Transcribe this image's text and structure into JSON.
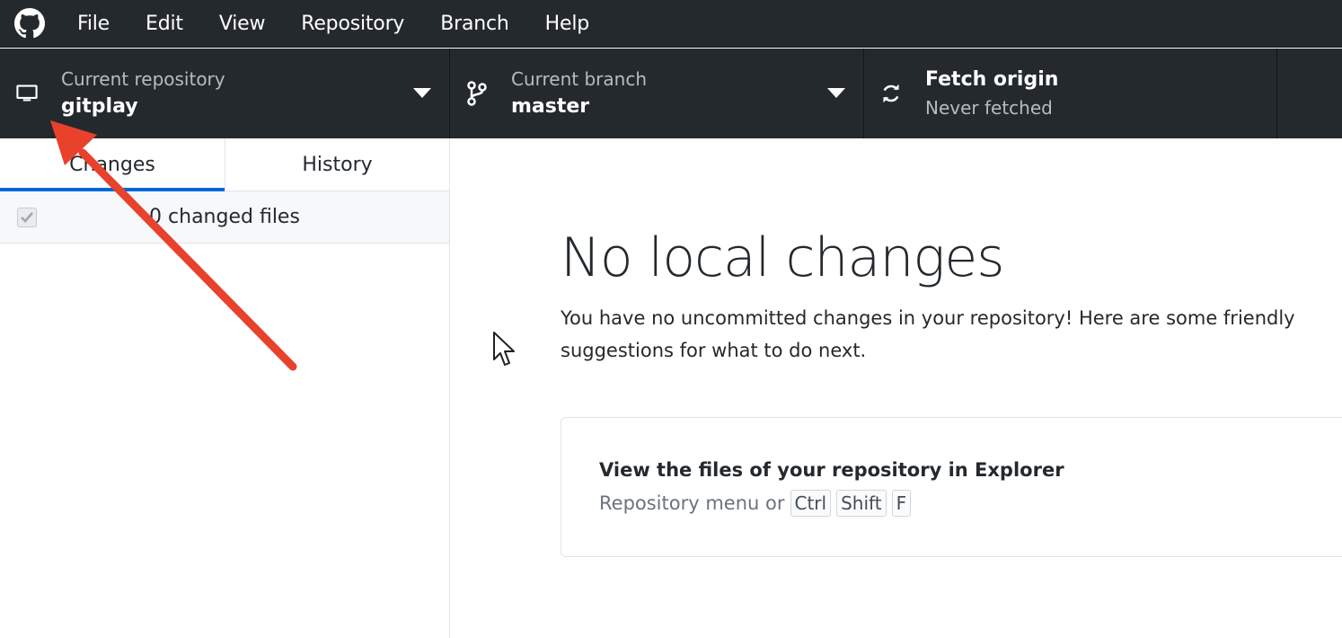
{
  "menubar": {
    "logo_icon": "github-octocat-icon",
    "items": [
      "File",
      "Edit",
      "View",
      "Repository",
      "Branch",
      "Help"
    ]
  },
  "toolbar": {
    "repo": {
      "label": "Current repository",
      "value": "gitplay",
      "icon": "monitor-icon"
    },
    "branch": {
      "label": "Current branch",
      "value": "master",
      "icon": "git-branch-icon"
    },
    "fetch": {
      "label": "Never fetched",
      "value": "Fetch origin",
      "icon": "sync-icon"
    }
  },
  "sidebar": {
    "tabs": [
      "Changes",
      "History"
    ],
    "active_tab": "Changes",
    "changes_count": "0 changed files"
  },
  "main": {
    "heading": "No local changes",
    "description": "You have no uncommitted changes in your repository! Here are some friendly suggestions for what to do next.",
    "card": {
      "title": "View the files of your repository in Explorer",
      "hint": "Repository menu or",
      "keys": [
        "Ctrl",
        "Shift",
        "F"
      ]
    }
  },
  "colors": {
    "toolbar_bg": "#24292e",
    "accent": "#0366d6",
    "annotation_arrow": "#e8412c"
  }
}
